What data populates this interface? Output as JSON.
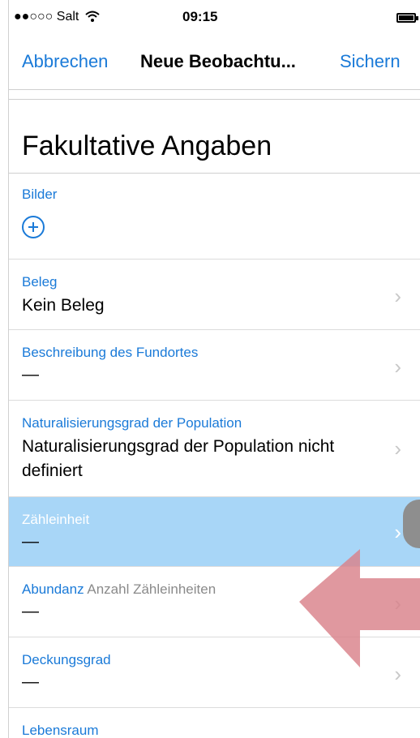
{
  "status_bar": {
    "carrier": "●●○○○ Salt",
    "time": "09:15"
  },
  "nav": {
    "cancel": "Abbrechen",
    "title": "Neue Beobachtu...",
    "save": "Sichern"
  },
  "section": {
    "title": "Fakultative Angaben"
  },
  "rows": [
    {
      "label": "Bilder"
    },
    {
      "label": "Beleg",
      "value": "Kein Beleg"
    },
    {
      "label": "Beschreibung des Fundortes",
      "value": "—"
    },
    {
      "label": "Naturalisierungsgrad der Population",
      "value": "Naturalisierungsgrad der Population nicht definiert"
    },
    {
      "label": "Zähleinheit",
      "value": "—"
    },
    {
      "label": "Abundanz",
      "sublabel": "Anzahl Zähleinheiten",
      "value": "—"
    },
    {
      "label": "Deckungsgrad",
      "value": "—"
    },
    {
      "label": "Lebensraum"
    }
  ],
  "colors": {
    "accent": "#1a7ad8",
    "highlight": "#a8d6f7",
    "arrow": "#d9818a"
  },
  "icons": {
    "add": "plus-circle-icon",
    "disclosure": "chevron-right-icon",
    "pointer": "arrow-left-icon"
  }
}
